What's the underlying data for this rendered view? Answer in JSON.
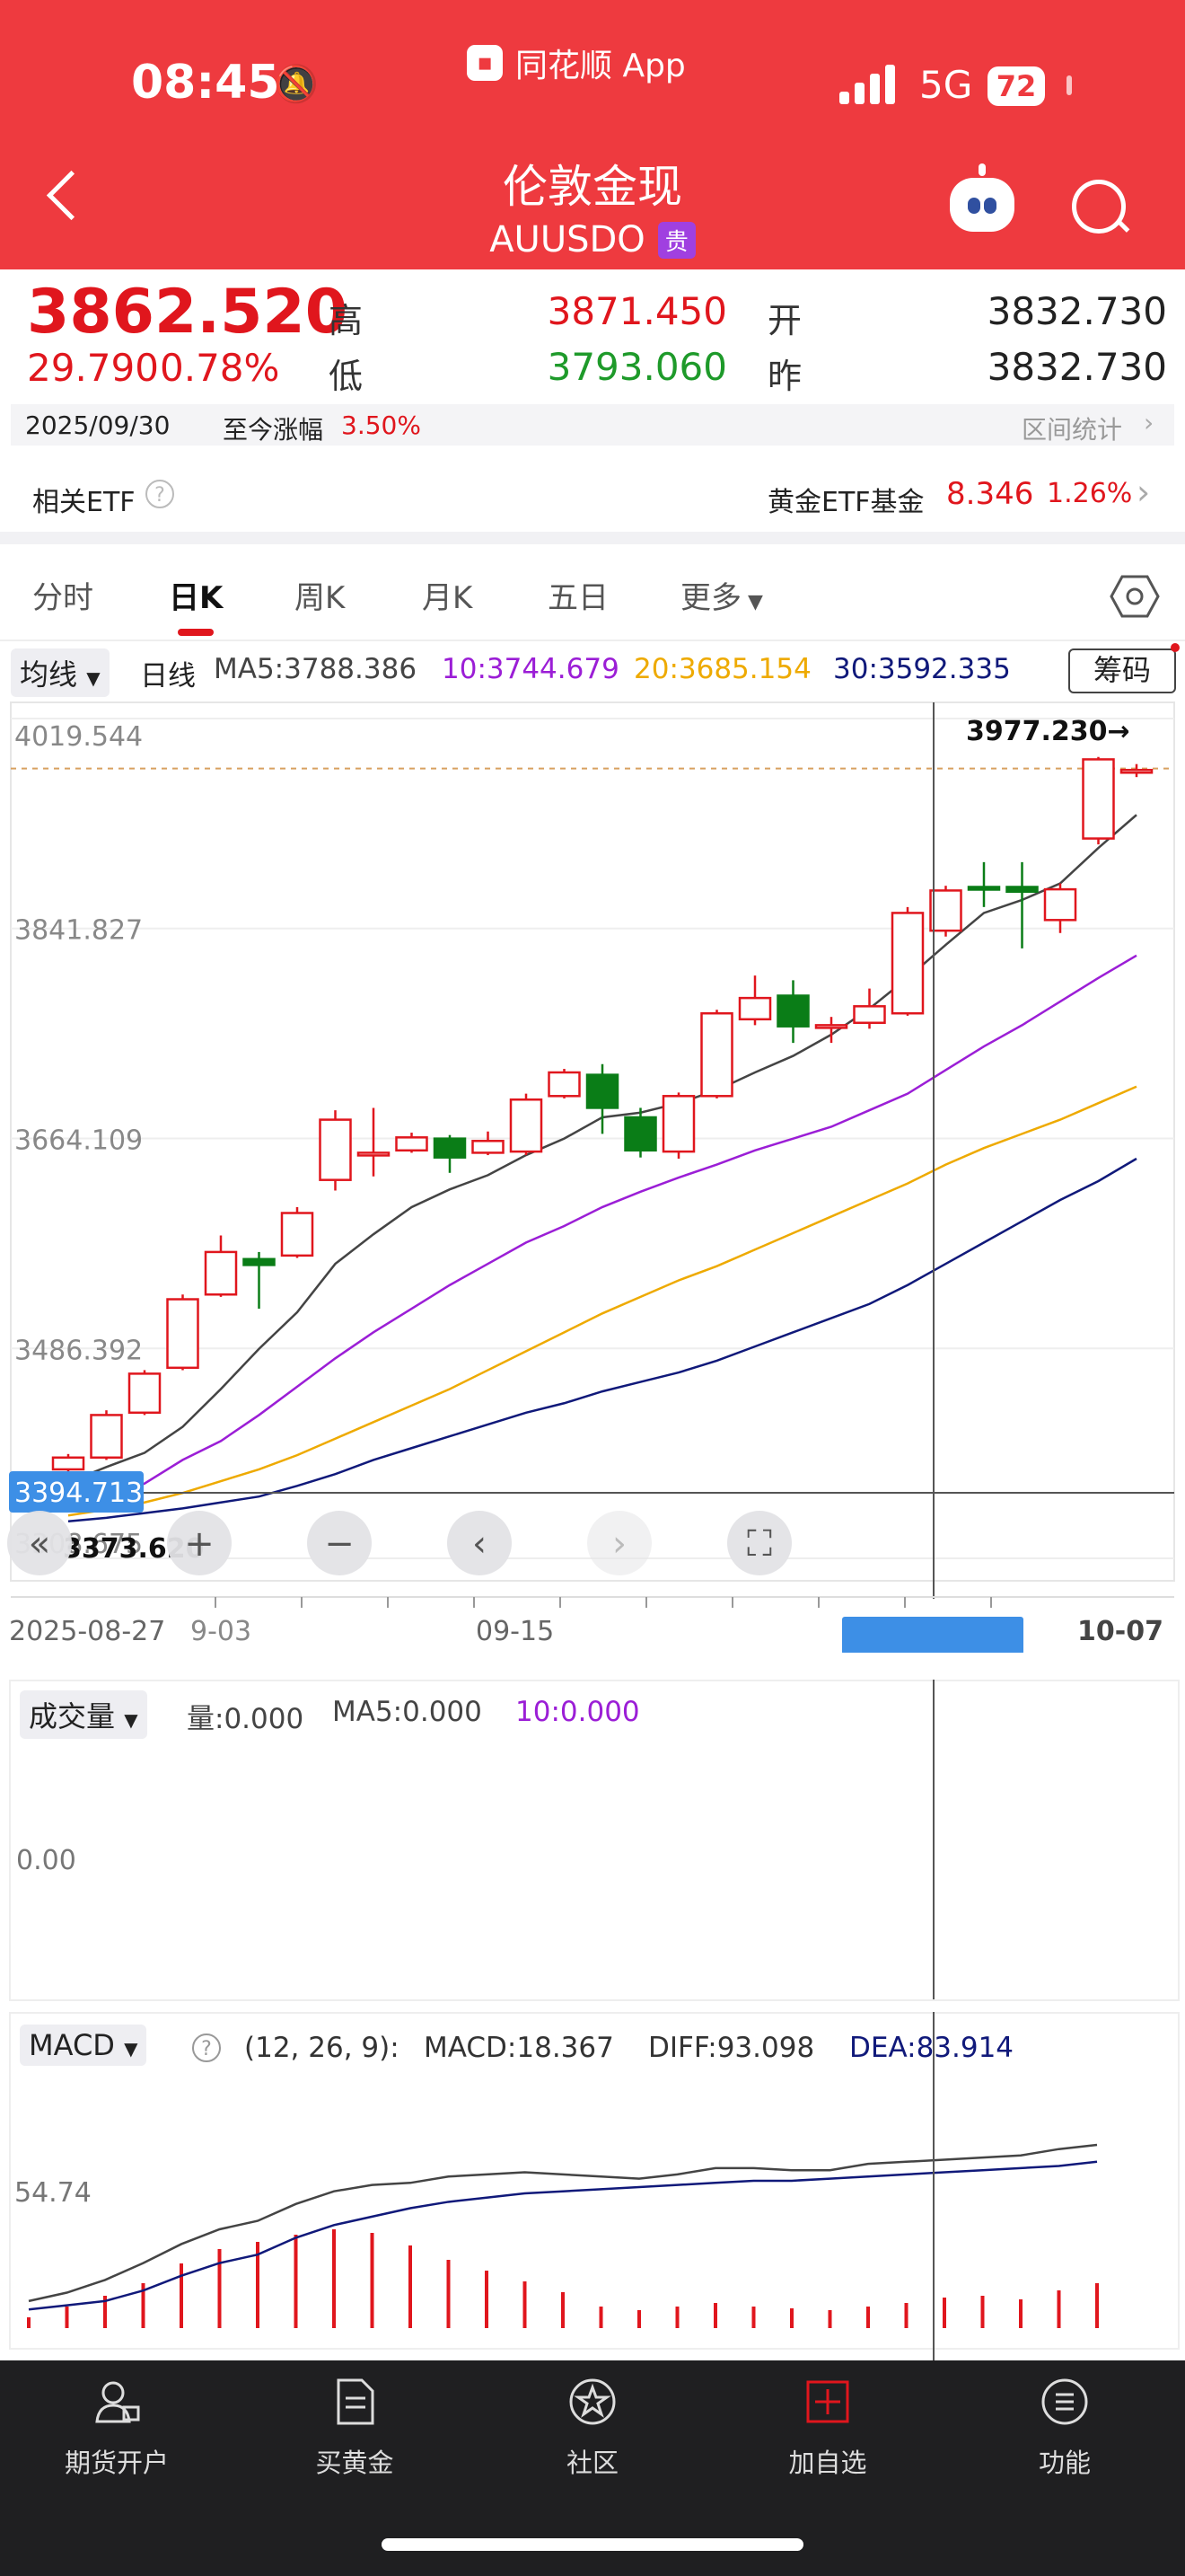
{
  "status": {
    "time": "08:45",
    "network": "5G",
    "battery": "72"
  },
  "app": {
    "name": "同花顺 App"
  },
  "header": {
    "title": "伦敦金现",
    "code": "AUUSDO",
    "tag": "贵"
  },
  "quote": {
    "price": "3862.520",
    "change": "29.790",
    "change_pct": "0.78%",
    "high_label": "高",
    "high": "3871.450",
    "low_label": "低",
    "low": "3793.060",
    "open_label": "开",
    "open": "3832.730",
    "prev_label": "昨",
    "prev": "3832.730",
    "date": "2025/09/30",
    "since_label": "至今涨幅",
    "since_value": "3.50%",
    "range_stats": "区间统计"
  },
  "etf": {
    "label": "相关ETF",
    "fund_label": "黄金ETF基金",
    "fund_price": "8.346",
    "fund_pct": "1.26%"
  },
  "tabs": [
    "分时",
    "日K",
    "周K",
    "月K",
    "五日",
    "更多"
  ],
  "ma_bar": {
    "selector": "均线",
    "period": "日线",
    "ma5": "MA5:3788.386",
    "ma10": "10:3744.679",
    "ma20": "20:3685.154",
    "ma30": "30:3592.335",
    "chip_button": "筹码"
  },
  "chart_labels": {
    "price_max": "4019.544",
    "price_2": "3841.827",
    "price_3": "3664.109",
    "price_4": "3486.392",
    "price_min_partial": "3308.675",
    "crosshair_price": "3394.713",
    "low_marker": "3373.620",
    "high_marker": "3977.230→",
    "date_start": "2025-08-27",
    "date_partial": "9-03",
    "date_mid": "09-15",
    "date_end": "10-07"
  },
  "volume": {
    "selector": "成交量",
    "vol": "量:0.000",
    "ma5": "MA5:0.000",
    "ma10": "10:0.000",
    "axis": "0.00"
  },
  "macd": {
    "selector": "MACD",
    "params": "(12, 26, 9):",
    "macd": "MACD:18.367",
    "diff": "DIFF:93.098",
    "dea": "DEA:83.914",
    "axis": "54.74"
  },
  "bottom_nav": [
    "期货开户",
    "买黄金",
    "社区",
    "加自选",
    "功能"
  ],
  "colors": {
    "up": "#e0161d",
    "down": "#0a7d17",
    "ma5": "#444444",
    "ma10": "#9b1ed6",
    "ma20": "#eeaa00",
    "ma30": "#10197a",
    "header": "#ee3a3f"
  },
  "chart_data": {
    "type": "candlestick",
    "ylim": [
      3308.675,
      4019.544
    ],
    "yticks": [
      4019.544,
      3841.827,
      3664.109,
      3486.392,
      3308.675
    ],
    "dates": [
      "2025-08-27",
      "",
      "",
      "",
      "",
      "",
      "",
      "",
      "",
      "",
      "",
      "",
      "",
      "09-15",
      "",
      "",
      "",
      "",
      "",
      "",
      "",
      "",
      "",
      "",
      "",
      "",
      "",
      "",
      "",
      "10-07"
    ],
    "candles": [
      [
        3384,
        3394,
        3376,
        3397
      ],
      [
        3394,
        3430,
        3392,
        3434
      ],
      [
        3432,
        3465,
        3430,
        3468
      ],
      [
        3470,
        3528,
        3468,
        3532
      ],
      [
        3532,
        3568,
        3530,
        3582
      ],
      [
        3562,
        3557,
        3520,
        3568
      ],
      [
        3565,
        3601,
        3563,
        3606
      ],
      [
        3629,
        3680,
        3620,
        3688
      ],
      [
        3652,
        3652,
        3632,
        3690
      ],
      [
        3654,
        3665,
        3652,
        3669
      ],
      [
        3664,
        3648,
        3635,
        3667
      ],
      [
        3652,
        3662,
        3650,
        3670
      ],
      [
        3653,
        3697,
        3650,
        3702
      ],
      [
        3700,
        3720,
        3698,
        3723
      ],
      [
        3718,
        3690,
        3668,
        3727
      ],
      [
        3682,
        3654,
        3648,
        3690
      ],
      [
        3653,
        3700,
        3647,
        3703
      ],
      [
        3700,
        3770,
        3698,
        3773
      ],
      [
        3765,
        3783,
        3760,
        3802
      ],
      [
        3785,
        3759,
        3745,
        3798
      ],
      [
        3759,
        3760,
        3745,
        3767
      ],
      [
        3762,
        3776,
        3757,
        3791
      ],
      [
        3770,
        3855,
        3768,
        3860
      ],
      [
        3840,
        3874,
        3835,
        3878
      ],
      [
        3877,
        3875,
        3860,
        3898
      ],
      [
        3877,
        3873,
        3825,
        3898
      ],
      [
        3849,
        3875,
        3838,
        3880
      ],
      [
        3918,
        3985,
        3913,
        3987
      ],
      [
        3974,
        3976,
        3970,
        3981
      ]
    ],
    "ma5": [
      3373,
      3386,
      3398,
      3420,
      3452,
      3486,
      3517,
      3558,
      3583,
      3606,
      3621,
      3633,
      3650,
      3664,
      3682,
      3686,
      3694,
      3705,
      3720,
      3734,
      3752,
      3774,
      3800,
      3828,
      3855,
      3866,
      3880,
      3910,
      3938
    ],
    "ma10": [
      3350,
      3361,
      3372,
      3392,
      3408,
      3430,
      3454,
      3478,
      3500,
      3520,
      3540,
      3558,
      3576,
      3590,
      3606,
      3619,
      3631,
      3642,
      3654,
      3664,
      3674,
      3688,
      3702,
      3722,
      3742,
      3760,
      3780,
      3800,
      3819
    ],
    "ma20": [
      3345,
      3350,
      3356,
      3364,
      3374,
      3384,
      3396,
      3410,
      3424,
      3438,
      3452,
      3468,
      3484,
      3500,
      3516,
      3530,
      3544,
      3556,
      3570,
      3584,
      3598,
      3612,
      3626,
      3642,
      3656,
      3668,
      3680,
      3694,
      3708
    ],
    "ma30": [
      3340,
      3343,
      3347,
      3351,
      3356,
      3361,
      3370,
      3380,
      3392,
      3402,
      3412,
      3422,
      3432,
      3440,
      3450,
      3458,
      3466,
      3476,
      3488,
      3500,
      3512,
      3524,
      3540,
      3558,
      3576,
      3594,
      3612,
      3628,
      3647
    ],
    "macd_bars": [
      6,
      12,
      18,
      25,
      36,
      44,
      48,
      52,
      55,
      53,
      46,
      38,
      32,
      26,
      20,
      12,
      10,
      12,
      14,
      12,
      11,
      10,
      12,
      14,
      17,
      18,
      16,
      21,
      25
    ],
    "diff": [
      20,
      24,
      30,
      38,
      47,
      54,
      58,
      66,
      72,
      75,
      76,
      79,
      80,
      81,
      80,
      79,
      78,
      80,
      83,
      83,
      82,
      82,
      85,
      86,
      87,
      88,
      89,
      92,
      94
    ],
    "dea": [
      16,
      18,
      20,
      25,
      32,
      38,
      42,
      50,
      56,
      60,
      64,
      67,
      69,
      71,
      72,
      73,
      74,
      75,
      76,
      77,
      77,
      78,
      79,
      80,
      81,
      82,
      83,
      84,
      86
    ]
  }
}
